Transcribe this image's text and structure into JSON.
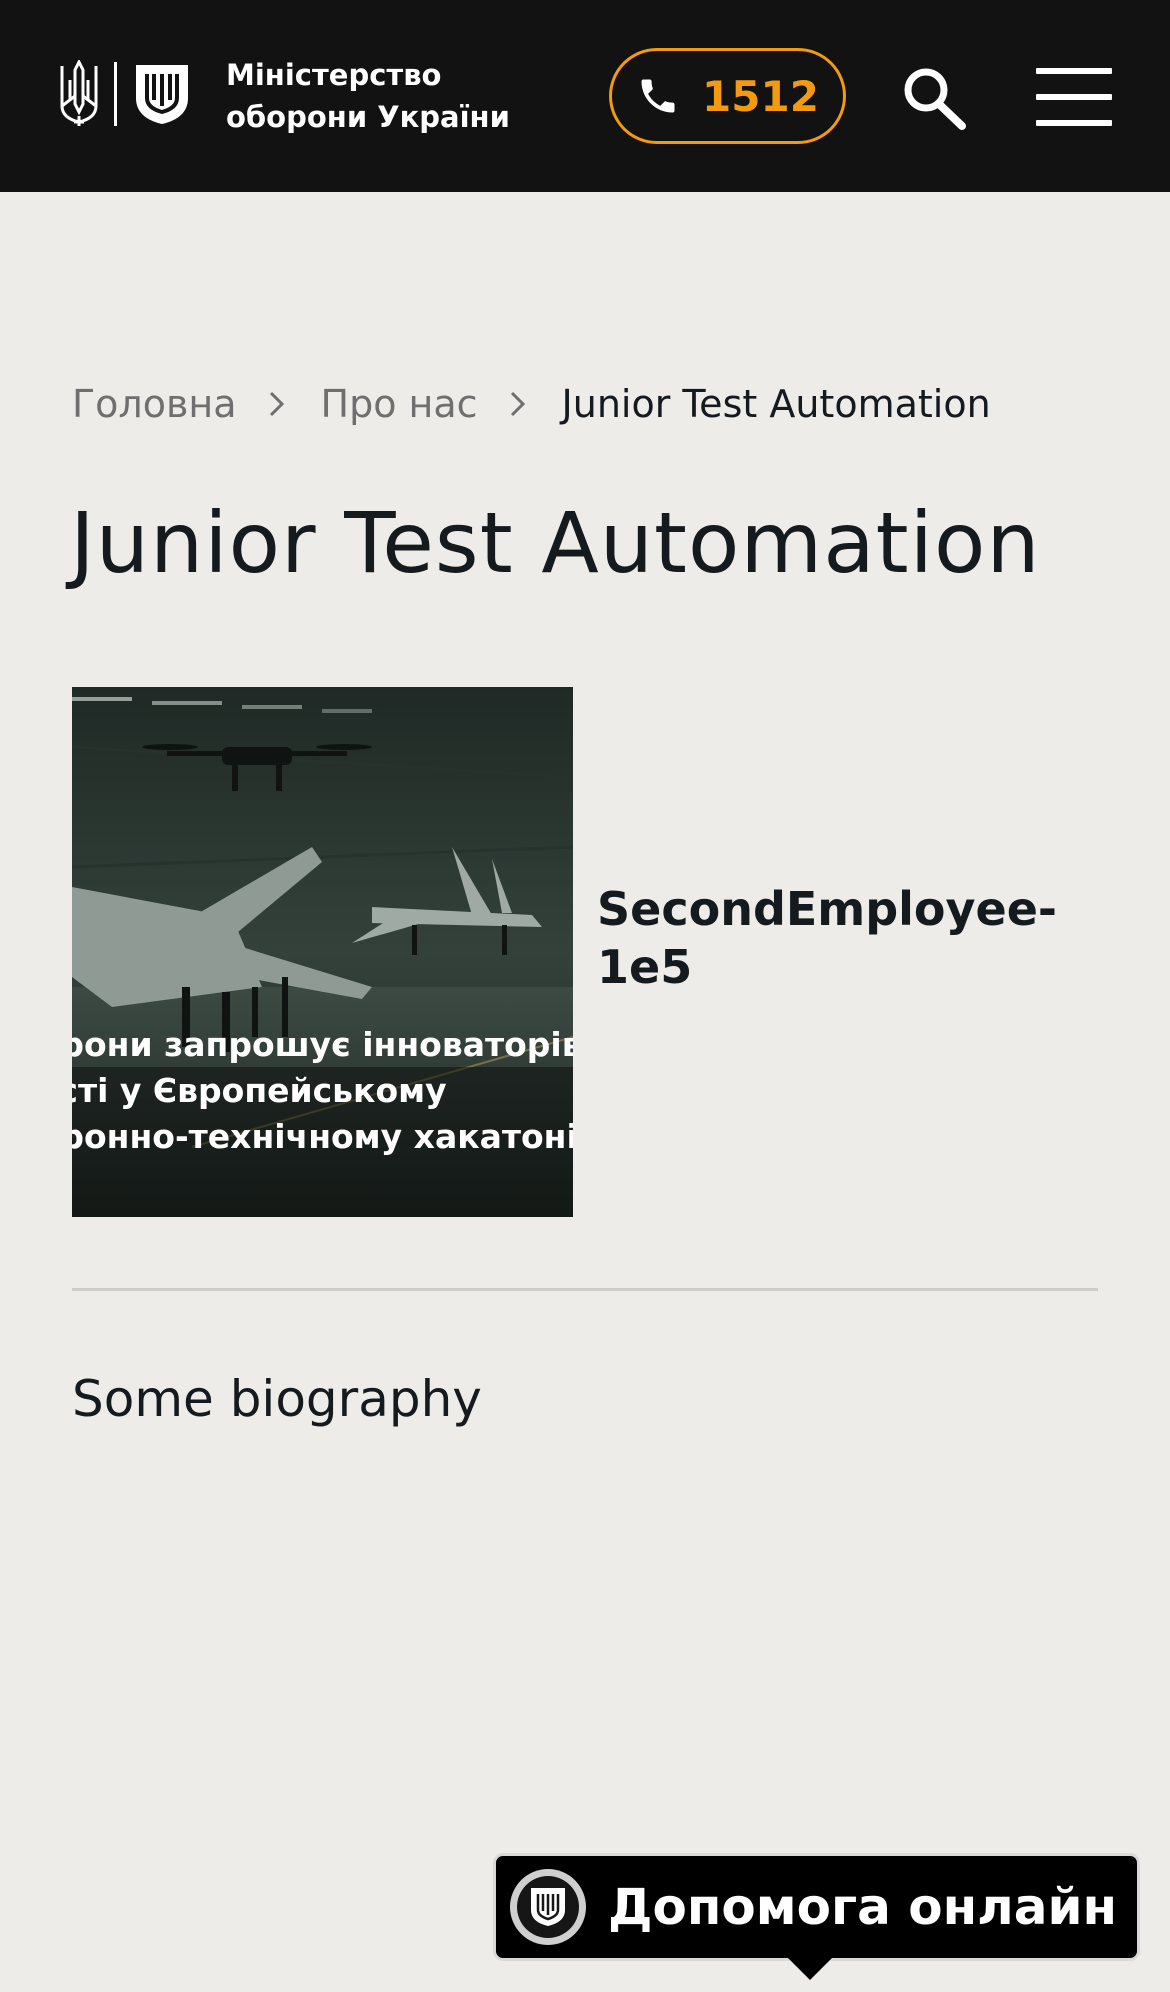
{
  "header": {
    "logo_line1": "Міністерство",
    "logo_line2": "оборони України",
    "hotline_number": "1512",
    "accent_color": "#f39a0f",
    "icons": [
      "trident-icon",
      "shield-icon",
      "phone-icon",
      "search-icon",
      "menu-icon"
    ]
  },
  "breadcrumb": {
    "items": [
      "Головна",
      "Про нас",
      "Junior Test Automation"
    ]
  },
  "page": {
    "title": "Junior Test Automation"
  },
  "employee": {
    "name": "SecondEmployee-1e5",
    "photo_caption": [
      "оборони запрошує інноваторів",
      "участі у Європейському",
      "оборонно-технічному хакатоні"
    ],
    "biography": "Some biography"
  },
  "help_widget": {
    "label": "Допомога онлайн"
  }
}
